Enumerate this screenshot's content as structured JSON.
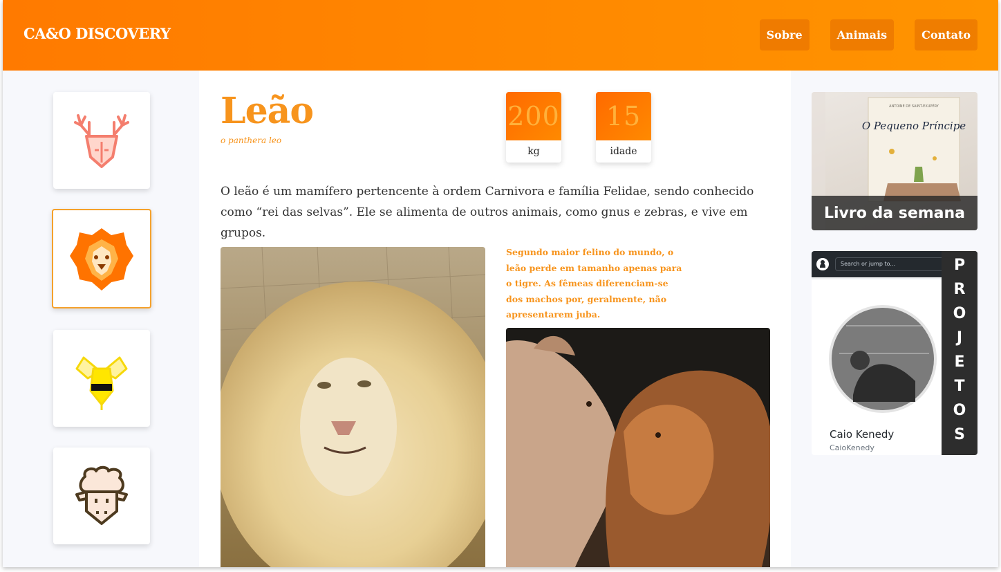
{
  "header": {
    "brand": "CA&O DISCOVERY",
    "nav": [
      "Sobre",
      "Animais",
      "Contato"
    ]
  },
  "sidebar": {
    "items": [
      {
        "animal": "deer",
        "icon": "deer-icon"
      },
      {
        "animal": "lion",
        "icon": "lion-icon",
        "active": true
      },
      {
        "animal": "bee",
        "icon": "bee-icon"
      },
      {
        "animal": "sheep",
        "icon": "sheep-icon"
      }
    ]
  },
  "animal": {
    "name": "Leão",
    "scientific": "o panthera leo",
    "stats": [
      {
        "value": "200",
        "label": "kg"
      },
      {
        "value": "15",
        "label": "idade"
      }
    ],
    "description": "O leão é um mamífero pertencente à ordem Carnivora e família Felidae, sendo conhecido como “rei das selvas”. Ele se alimenta de outros animais, como gnus e zebras, e vive em grupos.",
    "note": "Segundo maior felino do mundo, o leão perde em tamanho apenas para o tigre. As fêmeas diferenciam-se dos machos por, geralmente, não apresentarem juba."
  },
  "widgets": {
    "book": {
      "caption": "Livro da semana",
      "book_author": "ANTOINE DE SAINT-EXUPÉRY",
      "book_title": "O Pequeno Príncipe"
    },
    "projects": {
      "search_placeholder": "Search or jump to...",
      "name": "Caio Kenedy",
      "username": "CaioKenedy",
      "label_letters": [
        "P",
        "R",
        "O",
        "J",
        "E",
        "T",
        "O",
        "S"
      ]
    }
  },
  "colors": {
    "accent": "#f7941d",
    "header_start": "#ff7a00",
    "header_end": "#ff9400"
  }
}
